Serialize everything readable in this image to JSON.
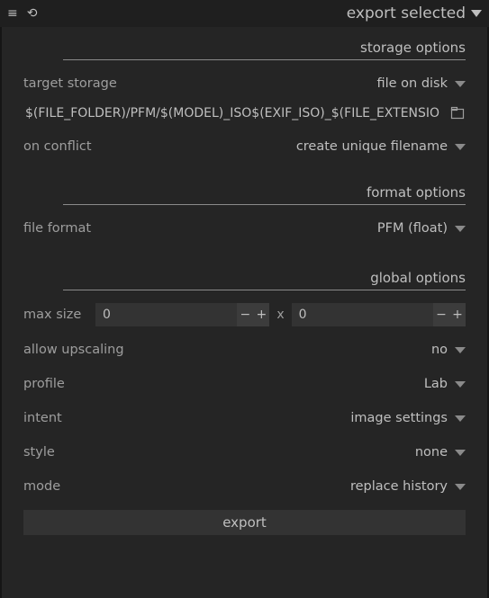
{
  "header": {
    "title": "export selected"
  },
  "sections": {
    "storage": {
      "title": "storage options"
    },
    "format": {
      "title": "format options"
    },
    "global": {
      "title": "global options"
    }
  },
  "storage": {
    "target_label": "target storage",
    "target_value": "file on disk",
    "path_value": "$(FILE_FOLDER)/PFM/$(MODEL)_ISO$(EXIF_ISO)_$(FILE_EXTENSION)",
    "conflict_label": "on conflict",
    "conflict_value": "create unique filename"
  },
  "format": {
    "file_format_label": "file format",
    "file_format_value": "PFM (float)"
  },
  "global": {
    "maxsize_label": "max size",
    "x_label": "x",
    "width": "0",
    "height": "0",
    "upscale_label": "allow upscaling",
    "upscale_value": "no",
    "profile_label": "profile",
    "profile_value": "Lab",
    "intent_label": "intent",
    "intent_value": "image settings",
    "style_label": "style",
    "style_value": "none",
    "mode_label": "mode",
    "mode_value": "replace history"
  },
  "export_button": "export"
}
